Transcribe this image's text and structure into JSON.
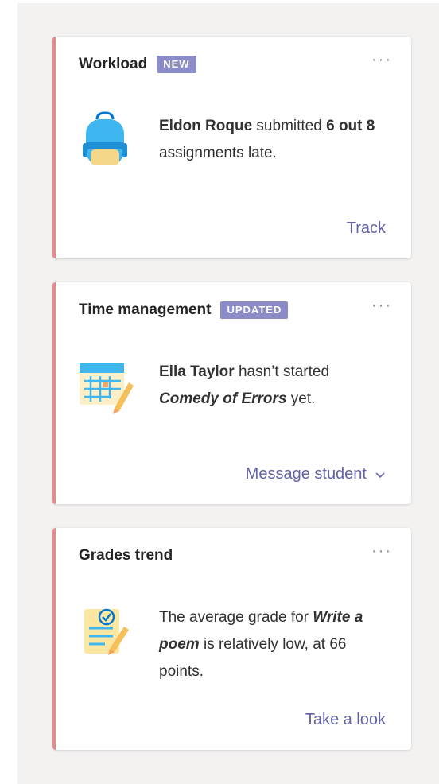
{
  "cards": [
    {
      "title": "Workload",
      "badge": "NEW",
      "more": "···",
      "icon": "backpack-icon",
      "text": {
        "name": "Eldon Roque",
        "mid": " submitted ",
        "count": "6 out 8",
        "tail": " assignments late."
      },
      "action": "Track"
    },
    {
      "title": "Time management",
      "badge": "UPDATED",
      "more": "···",
      "icon": "calendar-icon",
      "text": {
        "name": "Ella Taylor",
        "mid": " hasn’t started ",
        "assignment": "Comedy of Errors",
        "tail": " yet."
      },
      "action": "Message student"
    },
    {
      "title": "Grades trend",
      "more": "···",
      "icon": "notepad-icon",
      "text": {
        "head": "The average grade for ",
        "assignment": "Write a poem",
        "tail": " is relatively low, at 66 points."
      },
      "action": "Take a look"
    }
  ],
  "colors": {
    "accent": "#6264a7",
    "badge": "#8b8cc7",
    "stripe": "#e58b8b",
    "panel": "#f3f2f1"
  }
}
